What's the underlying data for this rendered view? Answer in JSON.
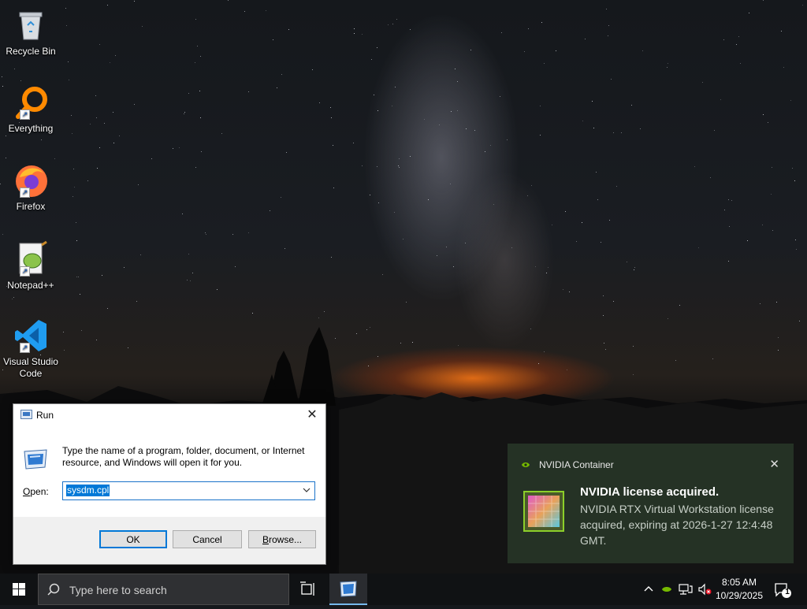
{
  "desktop": {
    "icons": [
      {
        "label": "Recycle Bin",
        "icon": "recycle-bin-icon"
      },
      {
        "label": "Everything",
        "icon": "everything-icon"
      },
      {
        "label": "Firefox",
        "icon": "firefox-icon"
      },
      {
        "label": "Notepad++",
        "icon": "notepadpp-icon"
      },
      {
        "label": "Visual Studio Code",
        "icon": "vscode-icon"
      }
    ]
  },
  "run_dialog": {
    "title": "Run",
    "description": "Type the name of a program, folder, document, or Internet resource, and Windows will open it for you.",
    "open_label_underlined": "O",
    "open_label_rest": "pen:",
    "open_value": "sysdm.cpl",
    "ok_label": "OK",
    "cancel_label": "Cancel",
    "browse_label_underlined": "B",
    "browse_label_rest": "rowse...",
    "close_glyph": "✕"
  },
  "notification": {
    "app_name": "NVIDIA Container",
    "heading": "NVIDIA license acquired.",
    "body": "NVIDIA RTX Virtual Workstation license acquired, expiring at 2026-1-27 12:4:48 GMT.",
    "dismiss_glyph": "✕",
    "accent": "#76b900"
  },
  "taskbar": {
    "search_placeholder": "Type here to search",
    "time": "8:05 AM",
    "date": "10/29/2025",
    "notification_count": "1"
  }
}
